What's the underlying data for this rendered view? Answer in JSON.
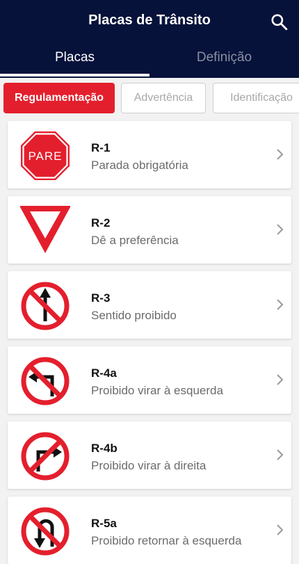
{
  "header": {
    "title": "Placas de Trânsito"
  },
  "tabs": [
    {
      "label": "Placas"
    },
    {
      "label": "Definição"
    }
  ],
  "filters": [
    {
      "label": "Regulamentação"
    },
    {
      "label": "Advertência"
    },
    {
      "label": "Identificação"
    }
  ],
  "items": [
    {
      "code": "R-1",
      "description": "Parada obrigatória",
      "sign_text": "PARE"
    },
    {
      "code": "R-2",
      "description": "Dê a preferência"
    },
    {
      "code": "R-3",
      "description": "Sentido proibido"
    },
    {
      "code": "R-4a",
      "description": "Proibido virar à esquerda"
    },
    {
      "code": "R-4b",
      "description": "Proibido virar à direita"
    },
    {
      "code": "R-5a",
      "description": "Proibido retornar à esquerda"
    }
  ],
  "colors": {
    "header_bg": "#06123a",
    "accent": "#e41f2d"
  }
}
